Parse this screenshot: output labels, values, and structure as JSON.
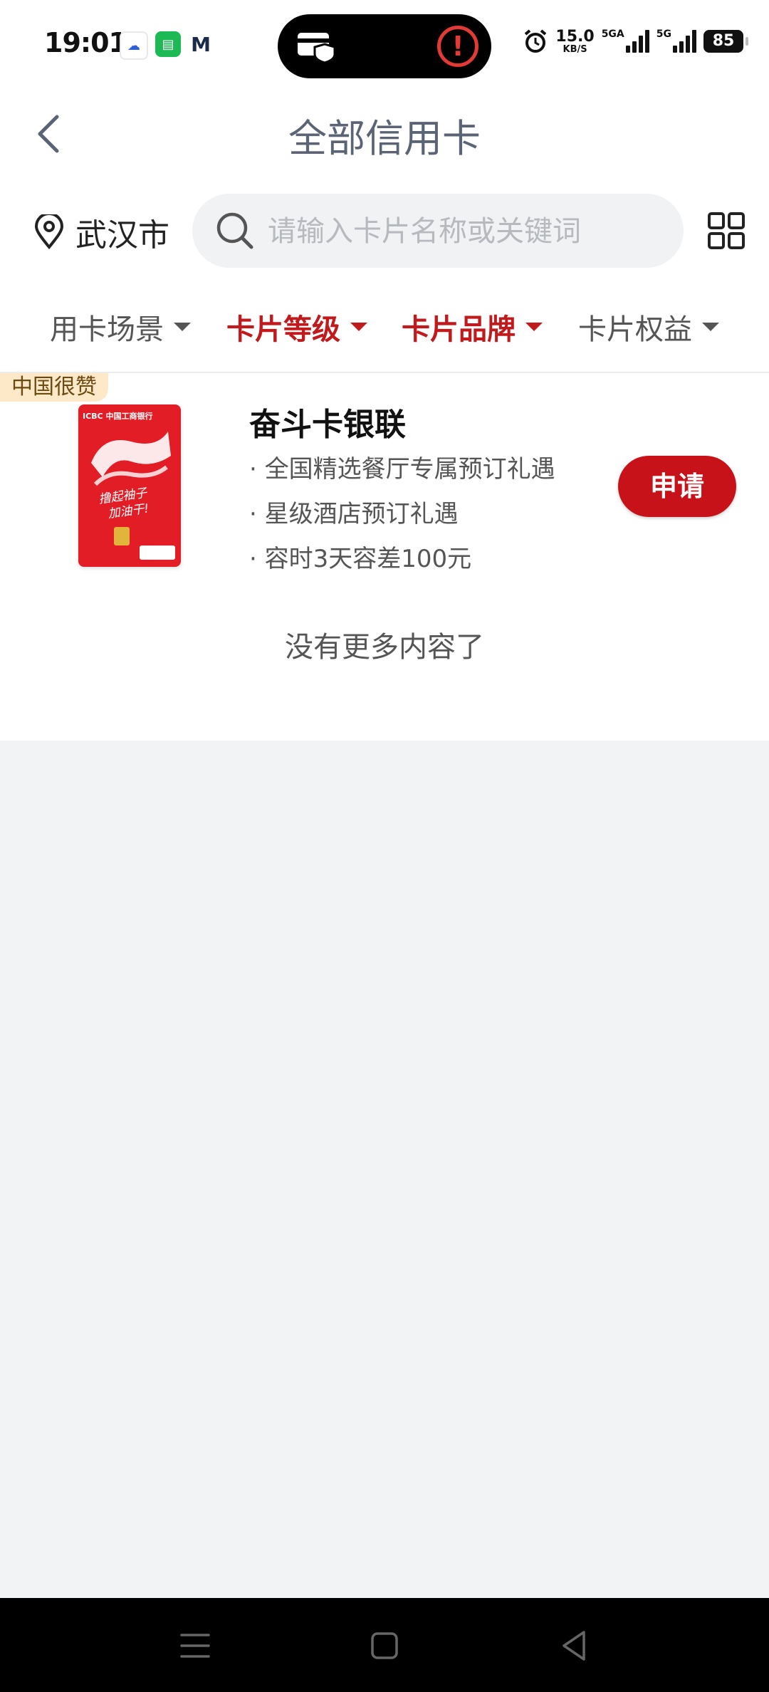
{
  "status_bar": {
    "time": "19:01",
    "net_speed_value": "15.0",
    "net_speed_unit": "KB/S",
    "signal_1_label": "5GA",
    "signal_2_label": "5G",
    "battery": "85"
  },
  "header": {
    "title": "全部信用卡"
  },
  "location": {
    "city": "武汉市"
  },
  "search": {
    "placeholder": "请输入卡片名称或关键词"
  },
  "filters": [
    {
      "label": "用卡场景",
      "active": false
    },
    {
      "label": "卡片等级",
      "active": true
    },
    {
      "label": "卡片品牌",
      "active": true
    },
    {
      "label": "卡片权益",
      "active": false
    }
  ],
  "cards": [
    {
      "tag": "中国很赞",
      "name": "奋斗卡银联",
      "perks": [
        "· 全国精选餐厅专属预订礼遇",
        "· 星级酒店预订礼遇",
        "· 容时3天容差100元"
      ],
      "apply_label": "申请",
      "image_text": {
        "bank": "ICBC 中国工商银行",
        "slogan_1": "撸起袖子",
        "slogan_2": "加油干!"
      }
    }
  ],
  "list_footer": "没有更多内容了",
  "colors": {
    "accent": "#c8121a",
    "active_filter": "#c01a1d",
    "tag_bg": "#fde9c8"
  }
}
